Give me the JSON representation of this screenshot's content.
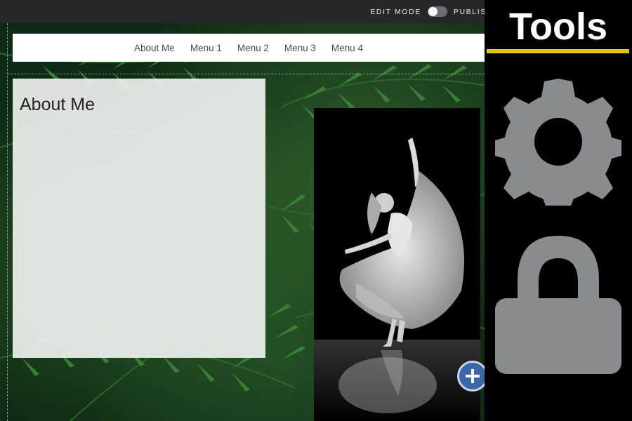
{
  "topbar": {
    "edit_mode_label": "EDIT MODE",
    "publish_label": "PUBLISH",
    "edit_mode_on": false
  },
  "nav": {
    "items": [
      {
        "label": "About Me"
      },
      {
        "label": "Menu 1"
      },
      {
        "label": "Menu 2"
      },
      {
        "label": "Menu 3"
      },
      {
        "label": "Menu 4"
      }
    ]
  },
  "about": {
    "heading": "About Me"
  },
  "tools": {
    "title": "Tools",
    "accent_color": "#e2c51a",
    "icons": [
      "gear-icon",
      "lock-icon"
    ]
  },
  "photo": {
    "subject": "dancer-image"
  }
}
